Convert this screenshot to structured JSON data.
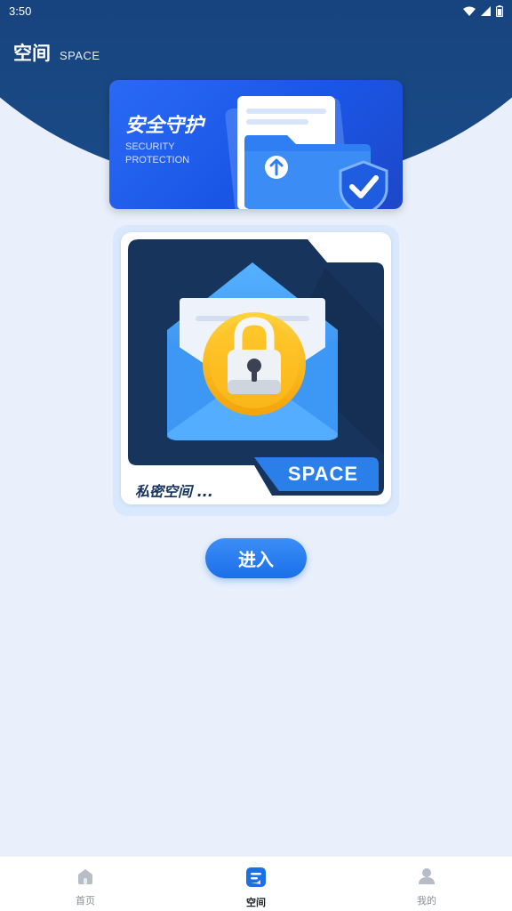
{
  "status_bar": {
    "time": "3:50"
  },
  "header": {
    "title": "空间",
    "subtitle": "SPACE"
  },
  "banner": {
    "title": "安全守护",
    "subtitle_line1": "SECURITY",
    "subtitle_line2": "PROTECTION"
  },
  "card": {
    "caption": "私密空间 ...",
    "tag": "SPACE"
  },
  "enter_button": {
    "label": "进入"
  },
  "bottom_nav": {
    "items": [
      {
        "label": "首页",
        "icon": "home-icon"
      },
      {
        "label": "空间",
        "icon": "space-icon",
        "active": true
      },
      {
        "label": "我的",
        "icon": "profile-icon"
      }
    ]
  },
  "colors": {
    "header_dark": "#0e2f5c",
    "accent_blue": "#1b6fe8",
    "background": "#e9f0fb",
    "card_dark": "#17345d",
    "lock_yellow": "#f7b511"
  }
}
